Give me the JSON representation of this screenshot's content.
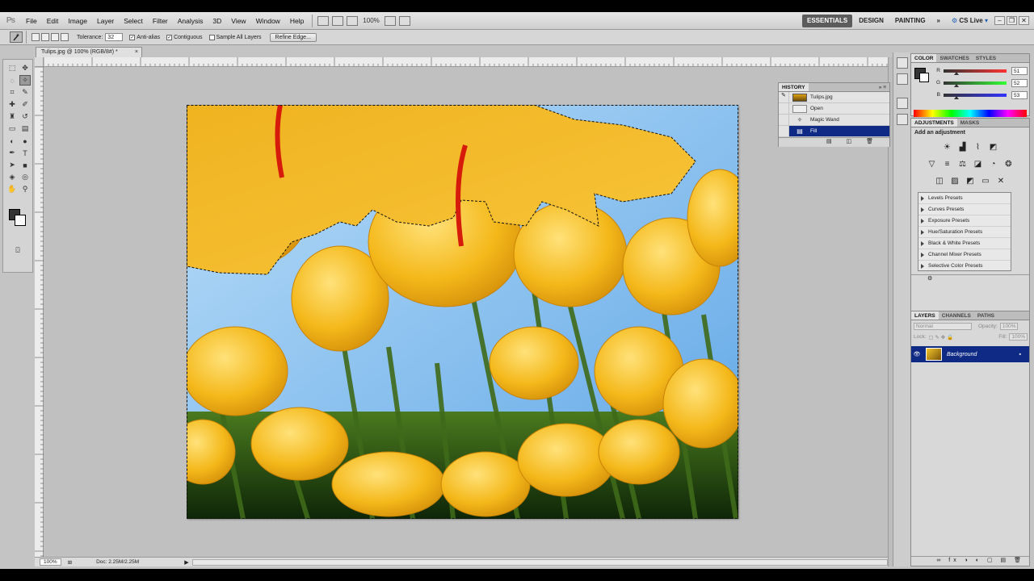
{
  "menubar": {
    "logo": "Ps",
    "items": [
      "File",
      "Edit",
      "Image",
      "Layer",
      "Select",
      "Filter",
      "Analysis",
      "3D",
      "View",
      "Window",
      "Help"
    ],
    "zoom": "100%",
    "workspaces": [
      "ESSENTIALS",
      "DESIGN",
      "PAINTING"
    ],
    "more": "»",
    "cslive": "CS Live"
  },
  "options": {
    "tolerance_label": "Tolerance:",
    "tolerance_value": "32",
    "antialias": "Anti-alias",
    "contiguous": "Contiguous",
    "sample_all": "Sample All Layers",
    "refine_edge": "Refine Edge..."
  },
  "document": {
    "tab_title": "Tulips.jpg @ 100% (RGB/8#) *",
    "close": "×"
  },
  "status": {
    "zoom": "100%",
    "doc_size": "Doc: 2.25M/2.25M"
  },
  "history": {
    "tab": "HISTORY",
    "snapshot": "Tulips.jpg",
    "steps": [
      "Open",
      "Magic Wand",
      "Fill"
    ],
    "selected_step": "Fill"
  },
  "color_panel": {
    "tabs": [
      "COLOR",
      "SWATCHES",
      "STYLES"
    ],
    "channels": [
      {
        "label": "R",
        "value": "51",
        "pos": 0.2
      },
      {
        "label": "G",
        "value": "52",
        "pos": 0.2
      },
      {
        "label": "B",
        "value": "53",
        "pos": 0.21
      }
    ],
    "foreground": "#333435"
  },
  "adjustments": {
    "tabs": [
      "ADJUSTMENTS",
      "MASKS"
    ],
    "heading": "Add an adjustment",
    "presets": [
      "Levels Presets",
      "Curves Presets",
      "Exposure Presets",
      "Hue/Saturation Presets",
      "Black & White Presets",
      "Channel Mixer Presets",
      "Selective Color Presets"
    ]
  },
  "layers": {
    "tabs": [
      "LAYERS",
      "CHANNELS",
      "PATHS"
    ],
    "blend_mode": "Normal",
    "opacity_label": "Opacity:",
    "opacity": "100%",
    "lock_label": "Lock:",
    "fill_label": "Fill:",
    "fill": "100%",
    "layer_name": "Background"
  }
}
